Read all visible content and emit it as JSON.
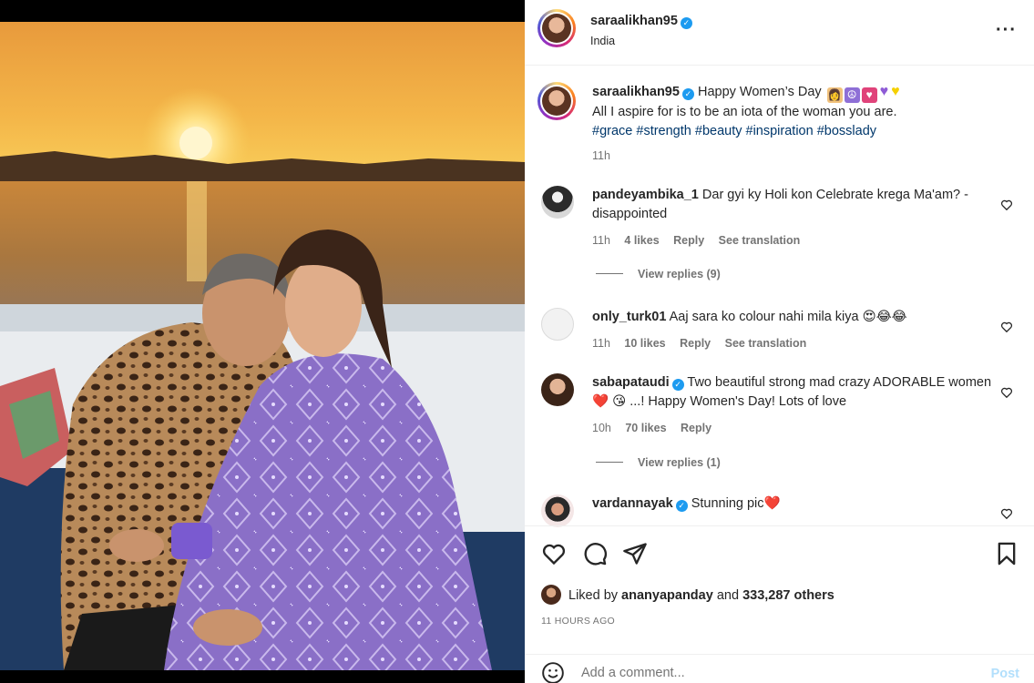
{
  "post": {
    "username": "saraalikhan95",
    "location": "India",
    "more_icon": "more-horizontal-icon",
    "caption_line1": "Happy Women’s Day",
    "caption_line2": "All I aspire for is to be an iota of the woman you are.",
    "hashtags": [
      "#grace",
      "#strength",
      "#beauty",
      "#inspiration",
      "#bosslady"
    ],
    "caption_time": "11h"
  },
  "comments": [
    {
      "username": "pandeyambika_1",
      "verified": false,
      "text": "Dar gyi ky Holi kon Celebrate krega Ma'am? -disappointed",
      "time": "11h",
      "likes": "4 likes",
      "reply": "Reply",
      "translate": "See translation",
      "view_replies": "View replies (9)"
    },
    {
      "username": "only_turk01",
      "verified": false,
      "text": "Aaj sara ko colour nahi mila kiya 😍😂😂",
      "time": "11h",
      "likes": "10 likes",
      "reply": "Reply",
      "translate": "See translation",
      "view_replies": ""
    },
    {
      "username": "sabapataudi",
      "verified": true,
      "text": "Two beautiful strong mad crazy ADORABLE women ❤️ 😘 ...! Happy Women's Day! Lots of love",
      "time": "10h",
      "likes": "70 likes",
      "reply": "Reply",
      "translate": "",
      "view_replies": "View replies (1)"
    },
    {
      "username": "vardannayak",
      "verified": true,
      "text": "Stunning pic❤️",
      "time": "",
      "likes": "",
      "reply": "",
      "translate": "",
      "view_replies": ""
    }
  ],
  "actions": {
    "liked_prefix": "Liked by",
    "liked_user": "ananyapanday",
    "liked_and": "and",
    "liked_count": "333,287 others",
    "timestamp": "11 HOURS AGO",
    "comment_placeholder": "Add a comment...",
    "post_label": "Post"
  },
  "colors": {
    "link": "#00376b",
    "muted": "#737373",
    "post_disabled": "#b2dffc",
    "verified": "#1d9bf0"
  }
}
